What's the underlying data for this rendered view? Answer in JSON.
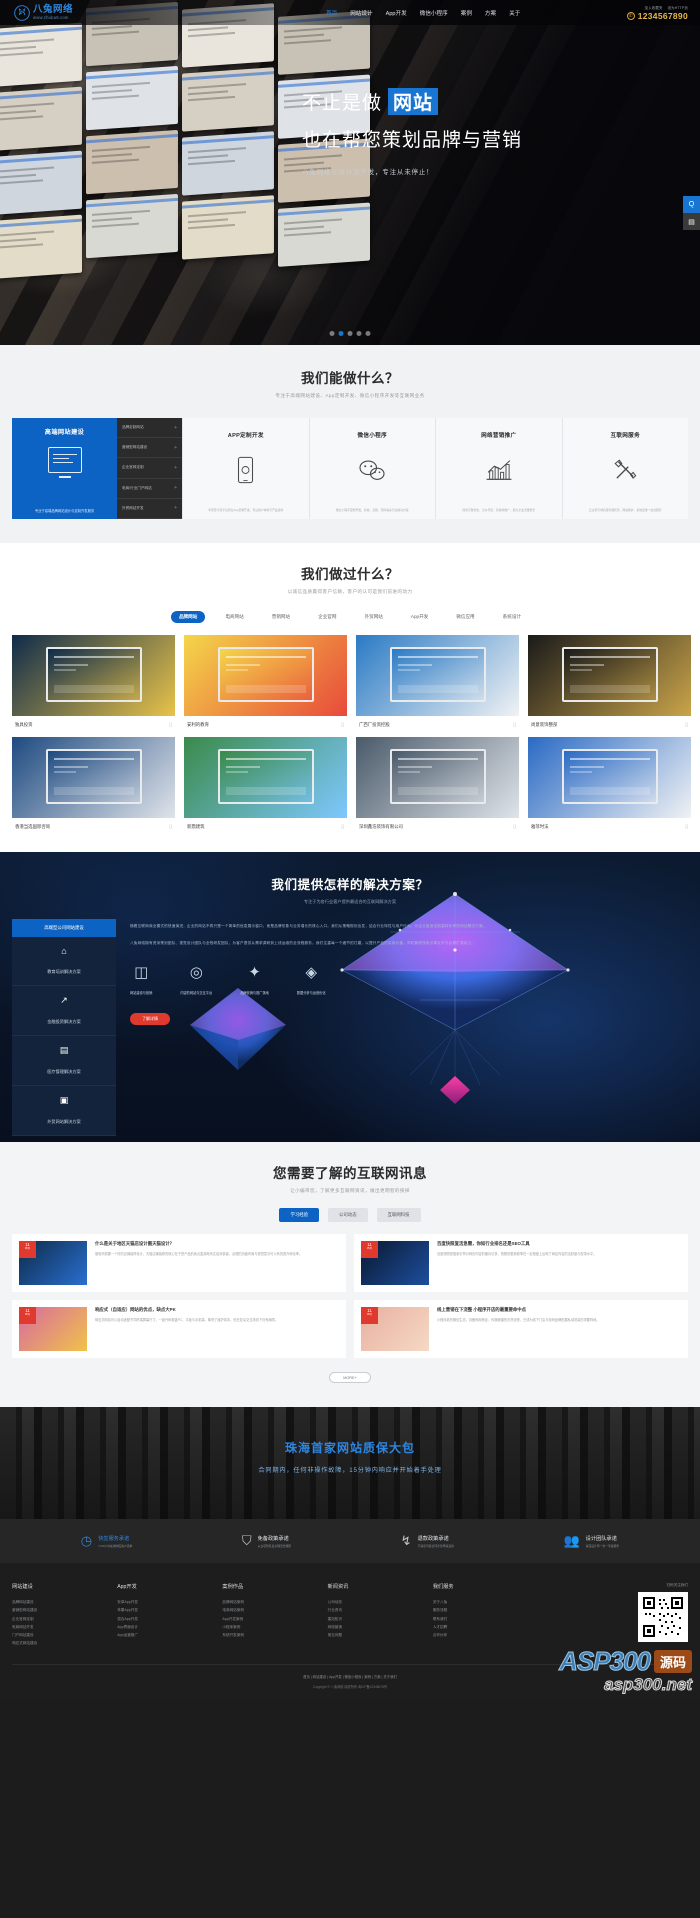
{
  "header": {
    "logo_name": "八兔网络",
    "logo_url": "www.zhuba8.com",
    "nav": [
      {
        "label": "首页",
        "active": true
      },
      {
        "label": "网站设计",
        "active": false
      },
      {
        "label": "App开发",
        "active": false
      },
      {
        "label": "微信小程序",
        "active": false
      },
      {
        "label": "案例",
        "active": false
      },
      {
        "label": "方案",
        "active": false
      },
      {
        "label": "关于",
        "active": false
      }
    ],
    "mini_links": [
      "加入收藏夹",
      "设为HTTP页"
    ],
    "phone": "1234567890",
    "phone_icon": "phone-icon"
  },
  "hero": {
    "line1_prefix": "不止是做",
    "line1_highlight": "网站",
    "line2": "也在帮您策划品牌与营销",
    "line3": "八兔网络从设计到开发，专注从未停止！",
    "side_widgets": [
      {
        "icon": "qq-icon",
        "label": "Q"
      },
      {
        "icon": "qrcode-icon",
        "label": "▤"
      }
    ],
    "dots": 5,
    "active_dot": 1
  },
  "services": {
    "title": "我们能做什么？",
    "subtitle": "专注于高端网站建设、App定制开发、微信小程序开发等互联网业务",
    "main": {
      "title": "高端网站建设",
      "icon": "monitor-icon",
      "footer": "专业于高端品牌网站设计与定制开发服务",
      "sub_items": [
        "品牌定制网站",
        "营销型网站建设",
        "企业官网定制",
        "电商/行业门户网站",
        "外贸网站开发"
      ]
    },
    "cards": [
      {
        "title": "APP定制开发",
        "icon": "mobile-icon",
        "desc": "苹果安卓双平台原生App定制开发，专注用户体验与产品落地"
      },
      {
        "title": "微信小程序",
        "icon": "wechat-icon",
        "desc": "微信小程序定制开发，商城、点餐、预约等多行业解决方案"
      },
      {
        "title": "网络营销推广",
        "icon": "chart-icon",
        "desc": "搜索引擎优化、竞价托管、新媒体推广，助力企业流量增长"
      },
      {
        "title": "互联网服务",
        "icon": "tools-icon",
        "desc": "云主机与域名服务器托管、网站维护、系统运维一站式服务"
      }
    ]
  },
  "portfolio": {
    "title": "我们做过什么？",
    "subtitle": "以诚信品质赢得客户信赖，客户的认可是我们前进的动力",
    "tabs": [
      {
        "label": "品牌网站",
        "active": true
      },
      {
        "label": "电商网站",
        "active": false
      },
      {
        "label": "营销网站",
        "active": false
      },
      {
        "label": "企业官网",
        "active": false
      },
      {
        "label": "外贸网站",
        "active": false
      },
      {
        "label": "App开发",
        "active": false
      },
      {
        "label": "微信应用",
        "active": false
      },
      {
        "label": "系统设计",
        "active": false
      }
    ],
    "cases": [
      {
        "name": "独具投资",
        "icon": "mobile-icon",
        "accent": "#0f2b4a",
        "accent2": "#e8c34a"
      },
      {
        "name": "安利的教育",
        "icon": "mobile-icon",
        "accent": "#f4d64a",
        "accent2": "#e84a3a"
      },
      {
        "name": "广西厂投资控股",
        "icon": "mobile-icon",
        "accent": "#2a7ac4",
        "accent2": "#f0f2f4"
      },
      {
        "name": "尚意装饰整部",
        "icon": "mobile-icon",
        "accent": "#1a1a1a",
        "accent2": "#c9a44a"
      },
      {
        "name": "香港当选国际咨询",
        "icon": "mobile-icon",
        "accent": "#1e4a80",
        "accent2": "#dfe4ea"
      },
      {
        "name": "新鼎建筑",
        "icon": "mobile-icon",
        "accent": "#3a8a4a",
        "accent2": "#7ec8ff"
      },
      {
        "name": "深圳鑫浩装饰有限公司",
        "icon": "mobile-icon",
        "accent": "#4a5a6a",
        "accent2": "#dfe4ea"
      },
      {
        "name": "雅菲时法",
        "icon": "mobile-icon",
        "accent": "#2a6ac4",
        "accent2": "#f0f2f4"
      }
    ]
  },
  "solutions": {
    "title": "我们提供怎样的解决方案？",
    "subtitle": "专注于为各行业客户提供最适合的互联网解决方案",
    "list_header": "高端型公司网站建设",
    "items": [
      {
        "label": "教育培训解决方案",
        "icon": "home-icon"
      },
      {
        "label": "金融投资解决方案",
        "icon": "trend-icon"
      },
      {
        "label": "医疗管理解决方案",
        "icon": "book-icon"
      },
      {
        "label": "外贸网站解决方案",
        "icon": "globe-icon"
      }
    ],
    "paragraphs": [
      "随着互联网商业模式的快速演进，企业的网站不再只是一个简单的信息展示窗口，而是品牌形象与业务增长的核心入口。我们从策略规划出发，结合行业特性与用户行为，为企业量身定制高转化率的网站解决方案。",
      "八兔网络拥有资深策划团队、视觉设计团队与全栈研发团队，为客户提供从需求调研到上线运维的全流程服务。我们注重每一个细节的打磨，以提升产品的实用价值，同时兼顾搜索引擎友好与后期扩展能力。"
    ],
    "features": [
      {
        "title": "网站建设与营销",
        "icon": "chart-icon"
      },
      {
        "title": "内容的网站与交互平台",
        "icon": "circle-icon"
      },
      {
        "title": "品牌营销与推广落地",
        "icon": "network-icon"
      },
      {
        "title": "数据分析与运营优化",
        "icon": "data-icon"
      }
    ],
    "button": "了解详情"
  },
  "news": {
    "title": "您需要了解的互联网讯息",
    "subtitle": "让小编带您，了解更多互联网资讯，做出更明智的抉择",
    "tabs": [
      {
        "label": "学习经验",
        "active": true
      },
      {
        "label": "公司动态",
        "active": false
      },
      {
        "label": "互联网科技",
        "active": false
      }
    ],
    "items": [
      {
        "date_d": "11",
        "date_m": "05月",
        "title": "什么是关于地区天猫店设计图天猫设计？",
        "desc": "做电商需要一个好的店铺装修设计，天猫店铺装修的核心在于把产品的卖点直观地传达给消费者，合理的页面布局与视觉层次可以有效提升转化率。"
      },
      {
        "date_d": "11",
        "date_m": "05月",
        "title": "百度快照复活急需，你知行业排名还是SEO工具",
        "desc": "百度快照是搜索引擎对网页内容的缓存记录，快照的更新频率在一定程度上反映了网站内容的活跃度与权重水平。"
      },
      {
        "date_d": "11",
        "date_m": "05月",
        "title": "响应式（自适应）网站的优点，缺点大PK",
        "desc": "响应式网站可以自动适配不同终端屏幕尺寸，一套代码覆盖PC、平板与手机端，降低了维护成本，但在复杂交互场景下仍有局限。"
      },
      {
        "date_d": "11",
        "date_m": "05月",
        "title": "线上营销在下浇整 小程序开店的最重要命中点",
        "desc": "小程序依托微信生态，具备即用即走、传播便捷的天然优势，已成为线下门店与电商品牌拓展私域流量的重要阵地。"
      }
    ],
    "more": "MORE+"
  },
  "promo": {
    "title": "珠海首家网站质保大包",
    "subtitle": "合同期内，任何非操作故障，15分钟内响应并开始着手处理"
  },
  "trust": [
    {
      "title": "快签服务承诺",
      "desc": "7×24小时在线响应客户需求",
      "icon": "clock-icon"
    },
    {
      "title": "免备政策承诺",
      "desc": "从立项到售后全程无忧保障",
      "icon": "shield-icon"
    },
    {
      "title": "退款政策承诺",
      "desc": "不满意可按合同条款申请退款",
      "icon": "refund-icon"
    },
    {
      "title": "设计团队承诺",
      "desc": "资深设计师一对一专属服务",
      "icon": "team-icon"
    }
  ],
  "footer": {
    "columns": [
      {
        "heading": "网站建设",
        "links": [
          "品牌网站建设",
          "营销型网站建设",
          "企业官网定制",
          "电商网站开发",
          "门户网站建设",
          "响应式网站建设"
        ]
      },
      {
        "heading": "App开发",
        "links": [
          "安卓App开发",
          "苹果App开发",
          "混合App开发",
          "App界面设计",
          "App运营推广"
        ]
      },
      {
        "heading": "案例作品",
        "links": [
          "品牌网站案例",
          "电商网站案例",
          "App开发案例",
          "小程序案例",
          "系统开发案例"
        ]
      },
      {
        "heading": "新闻资讯",
        "links": [
          "公司动态",
          "行业资讯",
          "建站知识",
          "网络营销",
          "常见问题"
        ]
      },
      {
        "heading": "我们服务",
        "links": [
          "关于八兔",
          "服务流程",
          "联系我们",
          "人才招聘",
          "合作伙伴"
        ]
      }
    ],
    "contact_label": "扫码关注我们",
    "qr_icon": "qrcode-icon",
    "bottom_links": [
      "首页",
      "网站建设",
      "App开发",
      "微信小程序",
      "案例",
      "方案",
      "关于我们"
    ],
    "copyright": "Copyright © 八兔网络 版权所有  粤ICP备12345678号"
  },
  "watermark": {
    "line1": "ASP300",
    "badge": "源码",
    "line2": "asp300.net"
  },
  "colors": {
    "brand_blue": "#0d63c4",
    "nav_active": "#2e86e0",
    "phone_gold": "#e8b94a",
    "accent_red": "#e03a2f",
    "dark_bg": "#1d1d1d"
  }
}
